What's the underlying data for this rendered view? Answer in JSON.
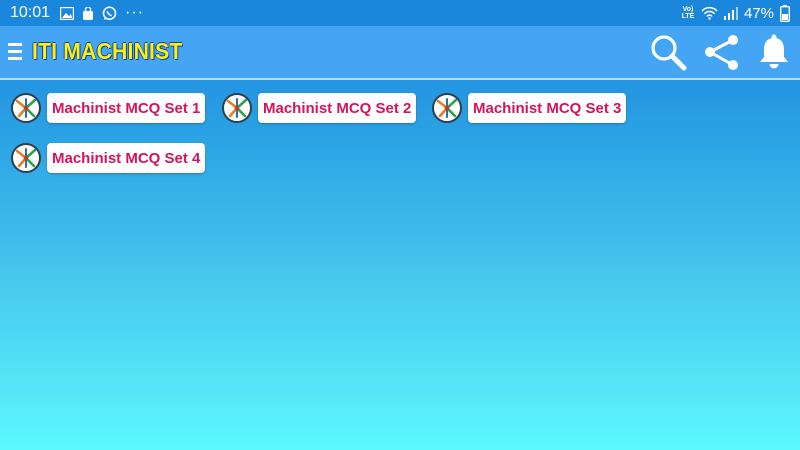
{
  "status_bar": {
    "time": "10:01",
    "left_icons": [
      "image-icon",
      "bag-icon",
      "whatsapp-icon",
      "more-dots-icon"
    ],
    "more_dots": "···",
    "network_label_top": "Vo)",
    "network_label_bottom": "LTE",
    "battery": "47%"
  },
  "app_bar": {
    "title": "ITI MACHINIST",
    "title_color": "#f6f21a",
    "background": "#43a5f3",
    "actions": [
      "search-icon",
      "share-icon",
      "bell-icon"
    ]
  },
  "sets": [
    {
      "label": "Machinist MCQ Set 1"
    },
    {
      "label": "Machinist MCQ Set 2"
    },
    {
      "label": "Machinist MCQ Set 3"
    },
    {
      "label": "Machinist MCQ Set 4"
    }
  ],
  "colors": {
    "button_text": "#d4145a",
    "gradient_top": "#1a80dc",
    "gradient_bottom": "#5cf8fd"
  }
}
